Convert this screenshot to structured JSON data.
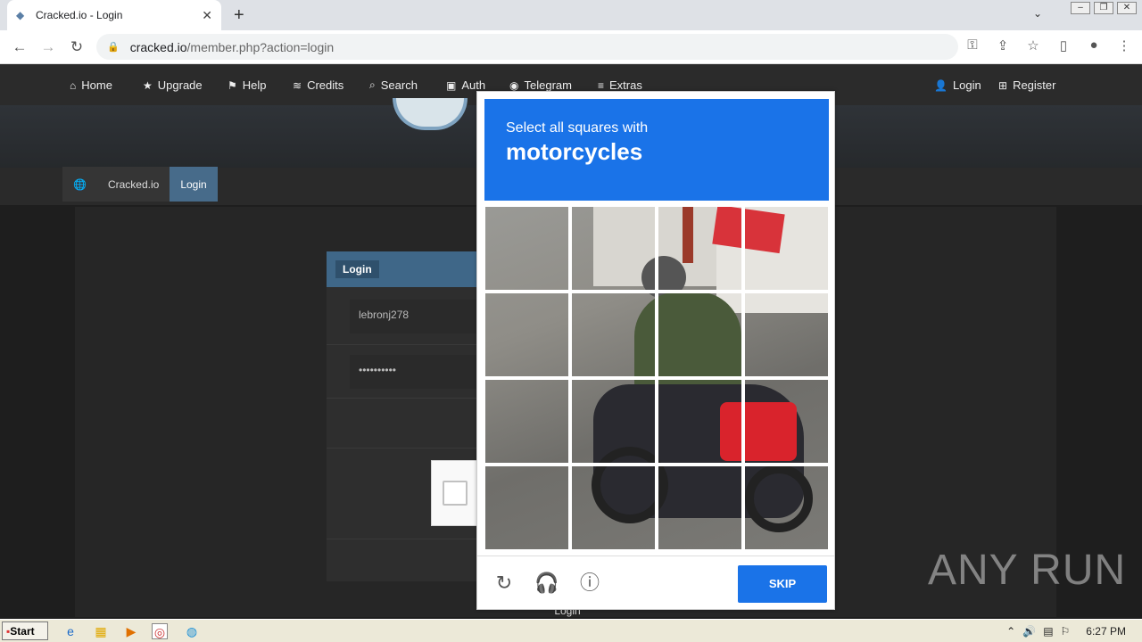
{
  "browser": {
    "tab_title": "Cracked.io - Login",
    "url_host": "cracked.io",
    "url_path": "/member.php?action=login"
  },
  "site_nav": {
    "items": [
      {
        "label": "Home",
        "icon": "home-icon"
      },
      {
        "label": "Upgrade",
        "icon": "star-icon"
      },
      {
        "label": "Help",
        "icon": "flag-icon"
      },
      {
        "label": "Credits",
        "icon": "coins-icon"
      },
      {
        "label": "Search",
        "icon": "search-icon"
      },
      {
        "label": "Auth",
        "icon": "lock-icon"
      },
      {
        "label": "Telegram",
        "icon": "telegram-icon"
      },
      {
        "label": "Extras",
        "icon": "menu-icon"
      }
    ],
    "right": [
      {
        "label": "Login",
        "icon": "user-icon"
      },
      {
        "label": "Register",
        "icon": "plus-icon"
      }
    ]
  },
  "breadcrumb": {
    "site": "Cracked.io",
    "current": "Login"
  },
  "login_form": {
    "header": "Login",
    "username": "lebronj278",
    "password_mask": "••••••••••",
    "submit_label": "Login"
  },
  "captcha": {
    "instruction": "Select all squares with",
    "target": "motorcycles",
    "skip_label": "SKIP"
  },
  "watermark": "ANY RUN",
  "taskbar": {
    "start": "Start",
    "clock": "6:27 PM"
  },
  "colors": {
    "captcha_blue": "#1a73e8",
    "site_accent": "#476b8a"
  }
}
